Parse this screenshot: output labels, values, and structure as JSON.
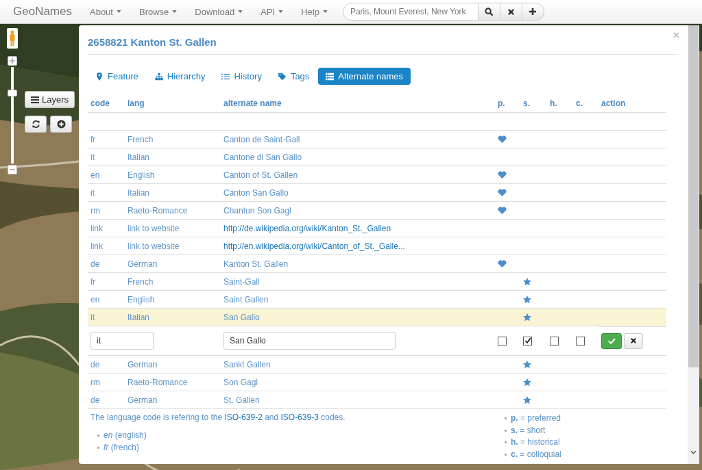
{
  "navbar": {
    "brand": "GeoNames",
    "menus": [
      "About",
      "Browse",
      "Download",
      "API",
      "Help"
    ],
    "search": {
      "placeholder": "Paris, Mount Everest, New York"
    }
  },
  "map_controls": {
    "layers_button": "Layers",
    "zoom": {
      "level": 0.75
    }
  },
  "dialog": {
    "title": "2658821 Kanton St. Gallen",
    "tabs": [
      {
        "kind": "feature",
        "label": "Feature",
        "selected": false
      },
      {
        "kind": "hierarchy",
        "label": "Hierarchy",
        "selected": false
      },
      {
        "kind": "history",
        "label": "History",
        "selected": false
      },
      {
        "kind": "tags",
        "label": "Tags",
        "selected": false
      },
      {
        "kind": "names",
        "label": "Alternate names",
        "selected": true
      }
    ],
    "columns": [
      "code",
      "lang",
      "alternate name",
      "p.",
      "s.",
      "h.",
      "c.",
      "action"
    ],
    "rows": [
      {
        "kind": "name",
        "code": "fr",
        "lang": "French",
        "name": "Canton de Saint-Gall",
        "preferred": true,
        "short": false,
        "selected": false
      },
      {
        "kind": "name",
        "code": "it",
        "lang": "Italian",
        "name": "Cantone di San Gallo",
        "preferred": false,
        "short": false,
        "selected": false
      },
      {
        "kind": "name",
        "code": "en",
        "lang": "English",
        "name": "Canton of St. Gallen",
        "preferred": true,
        "short": false,
        "selected": false
      },
      {
        "kind": "name",
        "code": "it",
        "lang": "Italian",
        "name": "Canton San Gallo",
        "preferred": true,
        "short": false,
        "selected": false
      },
      {
        "kind": "name",
        "code": "rm",
        "lang": "Raeto-Romance",
        "name": "Chantun Son Gagl",
        "preferred": true,
        "short": false,
        "selected": false
      },
      {
        "kind": "link",
        "code": "link",
        "lang": "link to website",
        "name": "http://de.wikipedia.org/wiki/Kanton_St._Gallen",
        "selected": false
      },
      {
        "kind": "link",
        "code": "link",
        "lang": "link to website",
        "name": "http://en.wikipedia.org/wiki/Canton_of_St._Galle...",
        "selected": false
      },
      {
        "kind": "name",
        "code": "de",
        "lang": "German",
        "name": "Kanton St. Gallen",
        "preferred": true,
        "short": false,
        "selected": false
      },
      {
        "kind": "name",
        "code": "fr",
        "lang": "French",
        "name": "Saint-Gall",
        "preferred": false,
        "short": true,
        "selected": false
      },
      {
        "kind": "name",
        "code": "en",
        "lang": "English",
        "name": "Saint Gallen",
        "preferred": false,
        "short": true,
        "selected": false
      },
      {
        "kind": "name",
        "code": "it",
        "lang": "Italian",
        "name": "San Gallo",
        "preferred": false,
        "short": true,
        "selected": true
      },
      {
        "kind": "edit",
        "code": "it",
        "name": "San Gallo",
        "preferred": false,
        "short": true,
        "historic": false,
        "colloquial": false,
        "selected": false
      },
      {
        "kind": "name",
        "code": "de",
        "lang": "German",
        "name": "Sankt Gallen",
        "preferred": false,
        "short": true,
        "selected": false
      },
      {
        "kind": "name",
        "code": "rm",
        "lang": "Raeto-Romance",
        "name": "Son Gagl",
        "preferred": false,
        "short": true,
        "selected": false
      },
      {
        "kind": "name",
        "code": "de",
        "lang": "German",
        "name": "St. Gallen",
        "preferred": false,
        "short": true,
        "selected": false
      }
    ],
    "note": {
      "before": "The language code is refering to the ",
      "link_1": "ISO-639-2",
      "middle": " and ",
      "link_2": "ISO-639-3",
      "after": " codes."
    },
    "examples": [
      "*en* (english)",
      "*fr* (french)"
    ],
    "legend": [
      "**p.** = preferred",
      "**s.** = short",
      "**h.** = historical",
      "**c.** = colloquial"
    ]
  }
}
